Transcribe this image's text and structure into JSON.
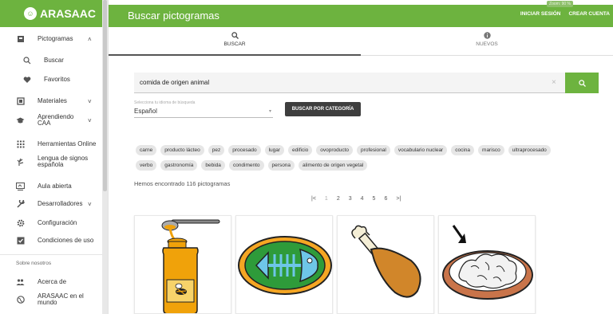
{
  "sidebar": {
    "logo": "ARASAAC",
    "items": [
      {
        "label": "Pictogramas",
        "icon": "pictograms-icon",
        "chevron": "˄"
      },
      {
        "label": "Buscar",
        "icon": "search-icon"
      },
      {
        "label": "Favoritos",
        "icon": "heart-icon"
      },
      {
        "label": "Materiales",
        "icon": "materials-icon",
        "chevron": "˅"
      },
      {
        "label": "Aprendiendo\nCAA",
        "icon": "graduation-cap-icon",
        "chevron": "˅"
      },
      {
        "label": "Herramientas Online",
        "icon": "apps-grid-icon"
      },
      {
        "label": "Lengua de signos\nespañola",
        "icon": "sign-language-icon"
      },
      {
        "label": "Aula abierta",
        "icon": "classroom-icon"
      },
      {
        "label": "Desarrolladores",
        "icon": "wrench-icon",
        "chevron": "˅"
      },
      {
        "label": "Configuración",
        "icon": "gear-icon"
      },
      {
        "label": "Condiciones de uso",
        "icon": "checkbox-icon"
      },
      {
        "label": "Acerca de",
        "icon": "people-icon"
      },
      {
        "label": "ARASAAC en el\nmundo",
        "icon": "globe-icon"
      }
    ],
    "section_label": "Sobre nosotros"
  },
  "topbar": {
    "title": "Buscar pictogramas",
    "login": "INICIAR SESIÓN",
    "register": "CREAR CUENTA",
    "zoom": "Zoom: 90 %"
  },
  "tabs": [
    {
      "label": "BUSCAR",
      "icon": "search-icon",
      "active": true
    },
    {
      "label": "NUEVOS",
      "icon": "info-icon",
      "active": false
    }
  ],
  "search": {
    "value": "comida de origen animal",
    "clear": "×"
  },
  "language": {
    "label": "Selecciona tu idioma de búsqueda",
    "value": "Español"
  },
  "category_button": "BUSCAR POR CATEGORÍA",
  "chips": {
    "row1": [
      "carne",
      "producto lácteo",
      "pez",
      "procesado",
      "lugar",
      "edificio",
      "ovoproducto",
      "profesional",
      "vocabulario nuclear",
      "cocina",
      "marisco",
      "ultraprocesado"
    ],
    "row2": [
      "verbo",
      "gastronomía",
      "bebida",
      "condimento",
      "persona",
      "alimento de origen vegetal"
    ]
  },
  "result_count": "Hemos encontrado 116 pictogramas",
  "pagination": {
    "first": "|<",
    "pages": [
      "1",
      "2",
      "3",
      "4",
      "5",
      "6"
    ],
    "current": "1",
    "last": ">|"
  },
  "cards": [
    {
      "name": "honey-pictogram"
    },
    {
      "name": "fish-bones-pictogram"
    },
    {
      "name": "chicken-leg-pictogram"
    },
    {
      "name": "plate-of-food-pictogram"
    }
  ],
  "colors": {
    "brand_green": "#6db33f",
    "dark_button": "#3e3e3e"
  }
}
